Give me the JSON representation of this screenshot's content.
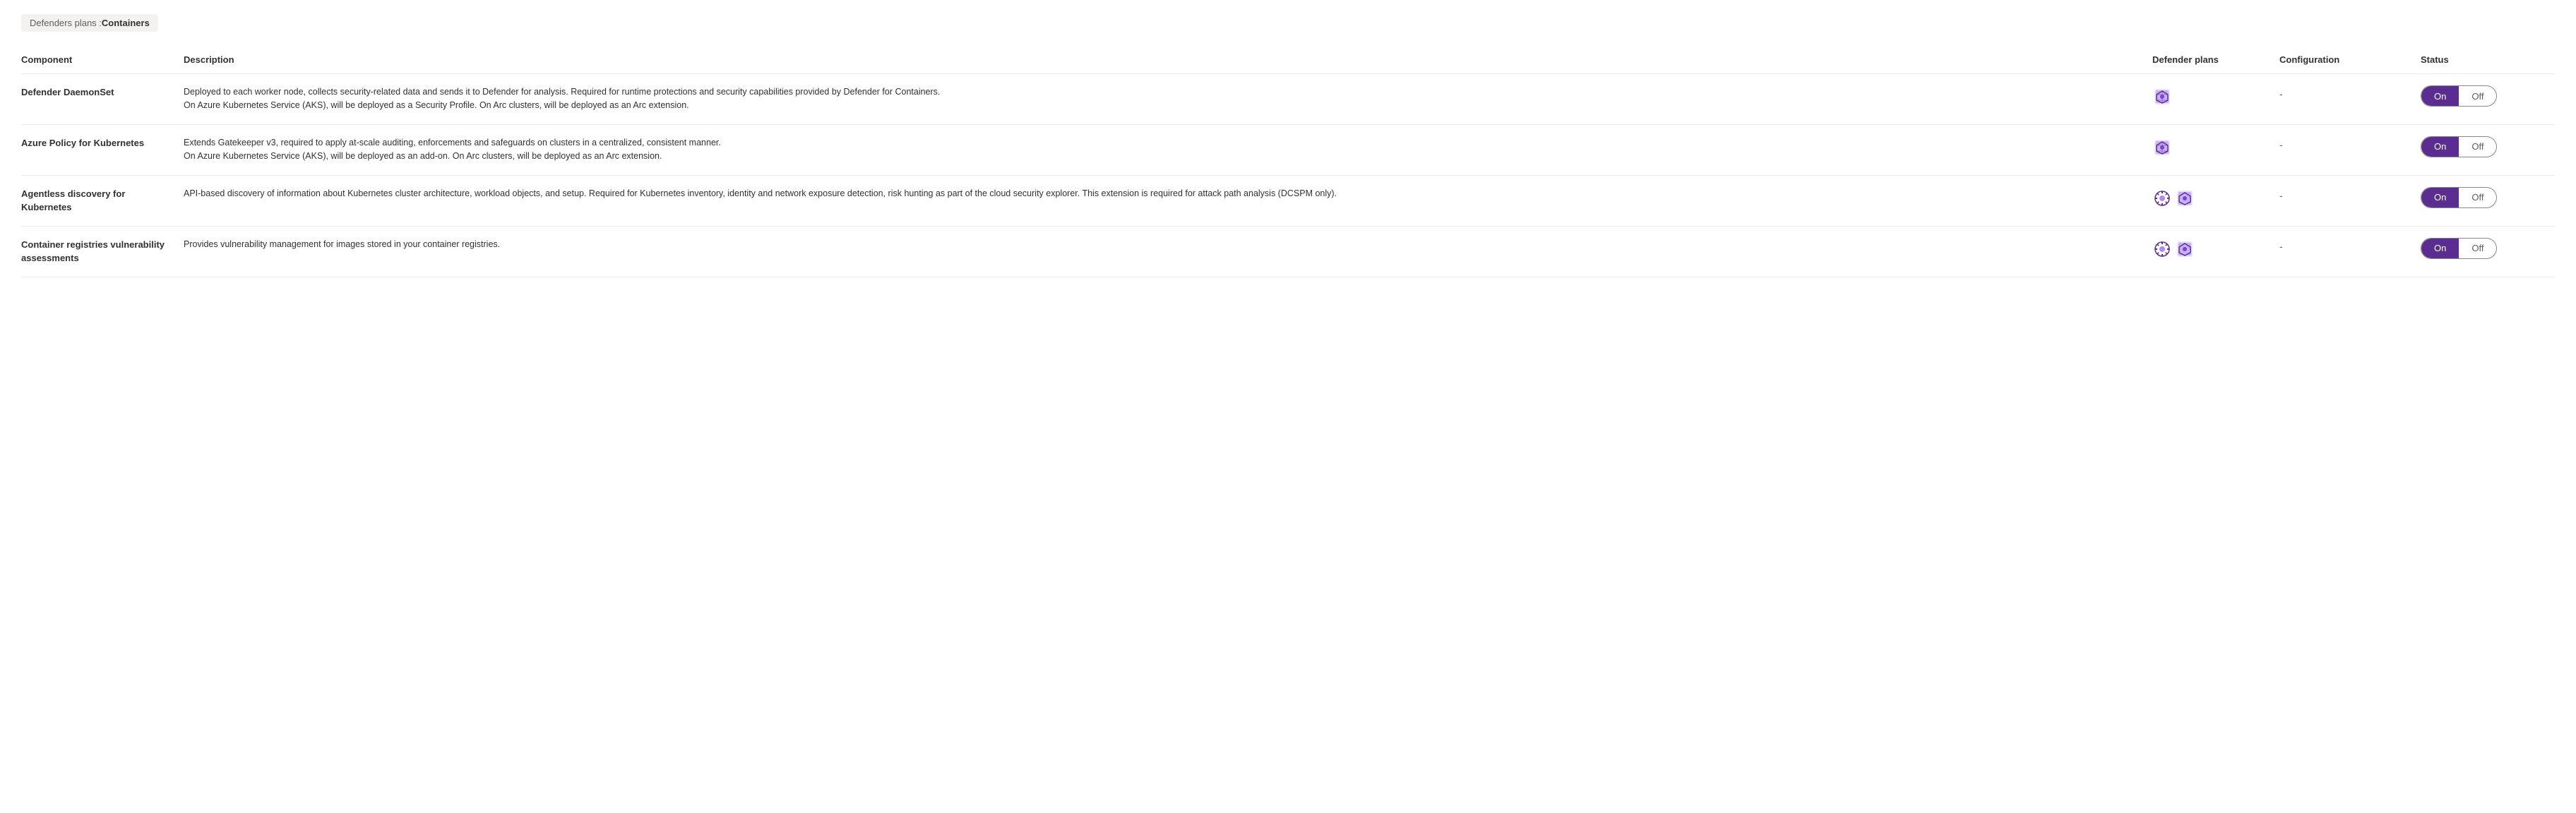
{
  "breadcrumb": {
    "prefix": "Defenders plans : ",
    "current": "Containers"
  },
  "table": {
    "columns": [
      "Component",
      "Description",
      "Defender plans",
      "Configuration",
      "Status"
    ],
    "rows": [
      {
        "id": "row-defender-daemonset",
        "component": "Defender DaemonSet",
        "description": "Deployed to each worker node, collects security-related data and sends it to Defender for analysis. Required for runtime protections and security capabilities provided by Defender for Containers.\nOn Azure Kubernetes Service (AKS), will be deployed as a Security Profile. On Arc clusters, will be deployed as an Arc extension.",
        "icon_type": "single",
        "configuration": "-",
        "status_on": "On",
        "status_off": "Off",
        "active": "on"
      },
      {
        "id": "row-azure-policy",
        "component": "Azure Policy for Kubernetes",
        "description": "Extends Gatekeeper v3, required to apply at-scale auditing, enforcements and safeguards on clusters in a centralized, consistent manner.\nOn Azure Kubernetes Service (AKS), will be deployed as an add-on. On Arc clusters, will be deployed as an Arc extension.",
        "icon_type": "single",
        "configuration": "-",
        "status_on": "On",
        "status_off": "Off",
        "active": "on"
      },
      {
        "id": "row-agentless-discovery",
        "component": "Agentless discovery for Kubernetes",
        "description": "API-based discovery of information about Kubernetes cluster architecture, workload objects, and setup. Required for Kubernetes inventory, identity and network exposure detection, risk hunting as part of the cloud security explorer. This extension is required for attack path analysis (DCSPM only).",
        "icon_type": "double",
        "configuration": "-",
        "status_on": "On",
        "status_off": "Off",
        "active": "on"
      },
      {
        "id": "row-container-registries",
        "component": "Container registries vulnerability assessments",
        "description": "Provides vulnerability management for images stored in your container registries.",
        "icon_type": "double",
        "configuration": "-",
        "status_on": "On",
        "status_off": "Off",
        "active": "on"
      }
    ]
  }
}
